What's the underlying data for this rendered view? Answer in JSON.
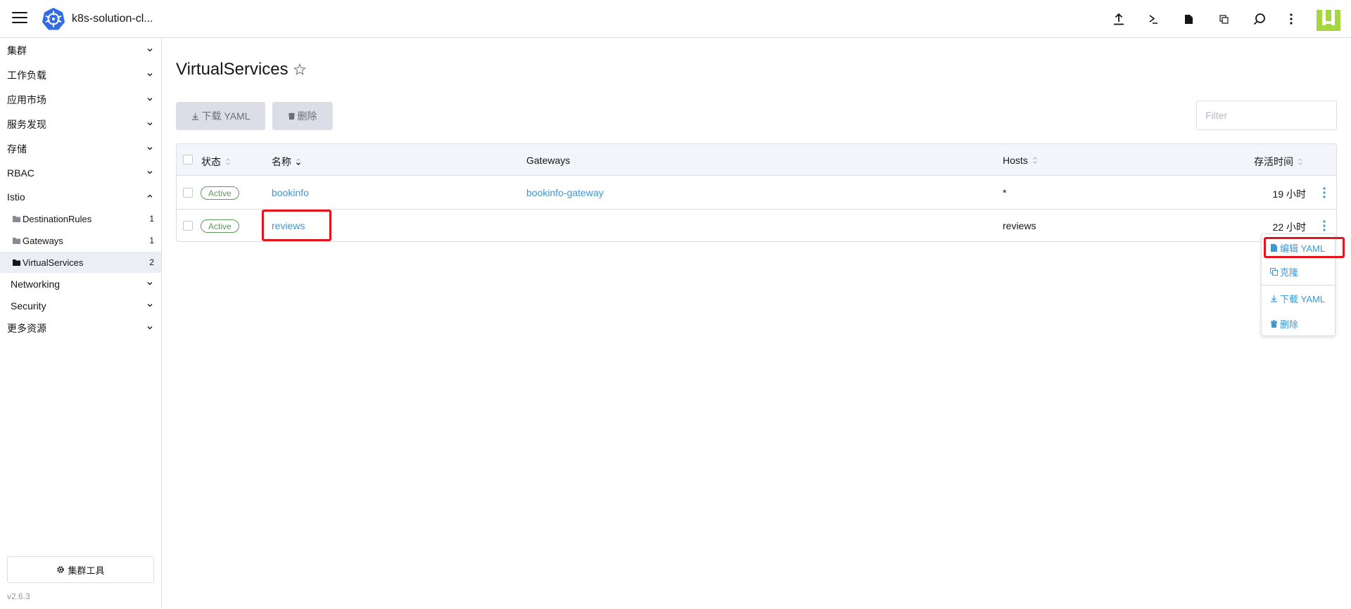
{
  "header": {
    "cluster_name": "k8s-solution-cl...",
    "icons": [
      "menu-icon",
      "kubernetes-logo",
      "upload-icon",
      "terminal-icon",
      "file-icon",
      "copy-icon",
      "search-icon",
      "more-vert-icon",
      "avatar"
    ]
  },
  "sidebar": {
    "groups": [
      {
        "label": "集群"
      },
      {
        "label": "工作负载"
      },
      {
        "label": "应用市场"
      },
      {
        "label": "服务发现"
      },
      {
        "label": "存储"
      },
      {
        "label": "RBAC"
      },
      {
        "label": "Istio",
        "expanded": true
      }
    ],
    "istio_children": [
      {
        "label": "DestinationRules",
        "count": "1"
      },
      {
        "label": "Gateways",
        "count": "1"
      },
      {
        "label": "VirtualServices",
        "count": "2",
        "active": true
      }
    ],
    "more_groups": [
      {
        "label": "Networking"
      },
      {
        "label": "Security"
      },
      {
        "label": "更多资源"
      }
    ],
    "cluster_tools": "集群工具",
    "version": "v2.6.3"
  },
  "main": {
    "title": "VirtualServices",
    "download_yaml": "下载 YAML",
    "delete": "删除",
    "filter_placeholder": "Filter",
    "columns": {
      "state": "状态",
      "name": "名称",
      "gateways": "Gateways",
      "hosts": "Hosts",
      "age": "存活时间"
    },
    "rows": [
      {
        "state": "Active",
        "name": "bookinfo",
        "gateways": "bookinfo-gateway",
        "hosts": "*",
        "age": "19 小时"
      },
      {
        "state": "Active",
        "name": "reviews",
        "gateways": "",
        "hosts": "reviews",
        "age": "22 小时"
      }
    ]
  },
  "menu": {
    "edit_yaml": "编辑 YAML",
    "clone": "克隆",
    "download_yaml": "下载 YAML",
    "delete": "删除"
  },
  "colors": {
    "accent": "#3d98d3",
    "active": "#5d995d",
    "highlight": "#e8141b",
    "button_bg": "#dcdee7"
  }
}
